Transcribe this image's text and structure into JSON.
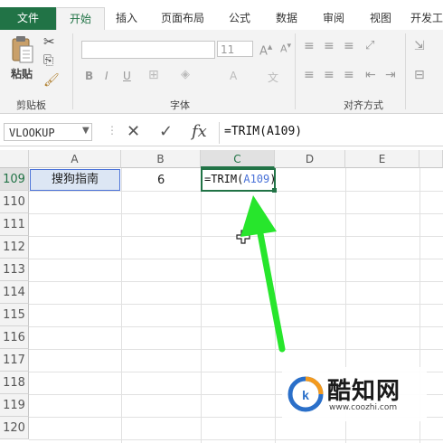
{
  "tabs": [
    "文件",
    "开始",
    "插入",
    "页面布局",
    "公式",
    "数据",
    "审阅",
    "视图",
    "开发工"
  ],
  "ribbon": {
    "paste_label": "粘贴",
    "groups": [
      "剪贴板",
      "字体",
      "对齐方式"
    ],
    "font_size": "11",
    "bold": "B",
    "italic": "I",
    "underline": "U",
    "font_color_glyph": "A",
    "phonetic_glyph": "文"
  },
  "formula_bar": {
    "name_box": "VLOOKUP",
    "formula": "=TRIM(A109)",
    "cancel_glyph": "✕",
    "enter_glyph": "✓",
    "fx_glyph": "fx"
  },
  "columns": [
    "A",
    "B",
    "C",
    "D",
    "E"
  ],
  "rows": [
    "109",
    "110",
    "111",
    "112",
    "113",
    "114",
    "115",
    "116",
    "117",
    "118",
    "119",
    "120"
  ],
  "cells": {
    "A109": "搜狗指南",
    "B109": "6",
    "C109_prefix": "=TRIM(",
    "C109_ref": "A109",
    "C109_suffix": ")"
  },
  "watermark": {
    "brand": "酷知网",
    "url": "www.coozhi.com"
  },
  "colors": {
    "excel_green": "#217346",
    "annotation_arrow": "#27e62c",
    "reference_blue": "#4a72d8",
    "watermark_blue": "#2a6fc9",
    "watermark_orange": "#f39a1e"
  }
}
